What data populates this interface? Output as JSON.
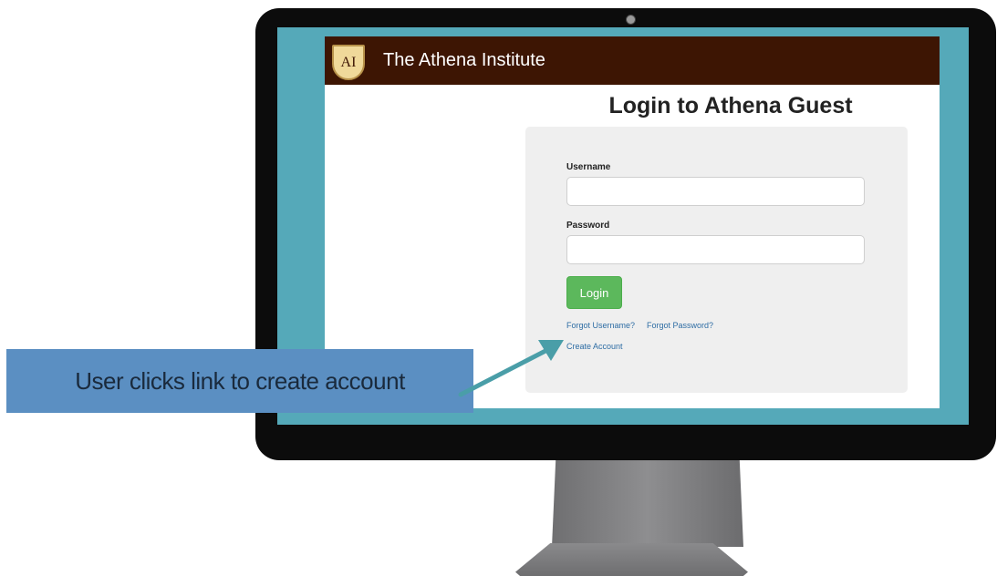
{
  "site": {
    "logo_text": "AI",
    "name": "The Athena Institute"
  },
  "page": {
    "title": "Login to Athena Guest"
  },
  "form": {
    "username_label": "Username",
    "username_value": "",
    "password_label": "Password",
    "password_value": "",
    "login_button": "Login",
    "links": {
      "forgot_username": "Forgot Username?",
      "forgot_password": "Forgot Password?",
      "create_account": "Create Account"
    }
  },
  "annotation": {
    "text": "User clicks link to create account"
  },
  "colors": {
    "header_bg": "#3d1503",
    "screen_bg": "#55a9b9",
    "button_green": "#5cb85c",
    "link_blue": "#2e6da4",
    "callout_bg": "#5b8fc2",
    "arrow": "#4a9ea8"
  }
}
